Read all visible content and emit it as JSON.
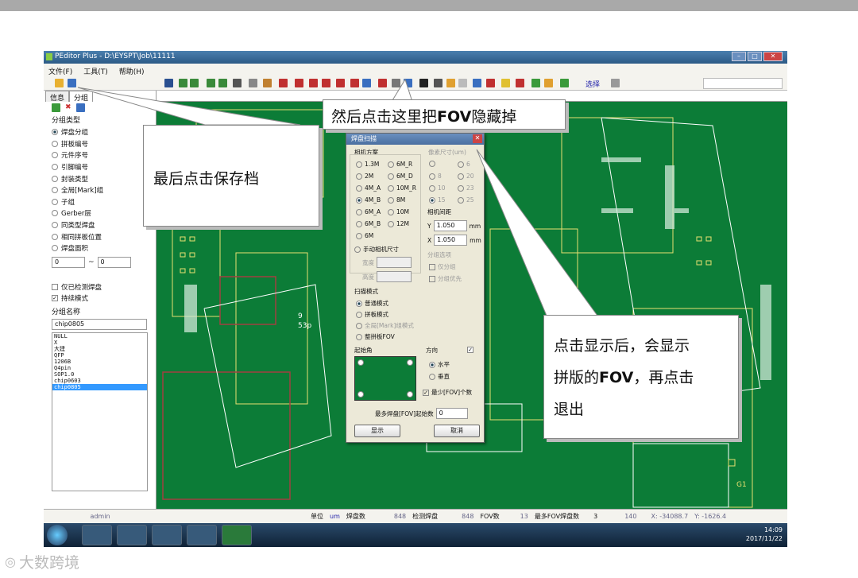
{
  "window": {
    "title": "PEditor Plus - D:\\EYSPT\\Job\\11111"
  },
  "menu": [
    "文件(F)",
    "工具(T)",
    "帮助(H)"
  ],
  "toolbar": {
    "select_label": "选择"
  },
  "left": {
    "tabs": [
      "信息",
      "分组"
    ],
    "group_type_label": "分组类型",
    "group_types": [
      {
        "label": "焊盘分组",
        "on": true
      },
      {
        "label": "拼板编号",
        "on": false
      },
      {
        "label": "元件序号",
        "on": false
      },
      {
        "label": "引脚编号",
        "on": false
      },
      {
        "label": "封装类型",
        "on": false
      },
      {
        "label": "全局[Mark]组",
        "on": false
      },
      {
        "label": "子组",
        "on": false
      },
      {
        "label": "Gerber层",
        "on": false
      },
      {
        "label": "同类型焊盘",
        "on": false
      },
      {
        "label": "相同拼板位置",
        "on": false
      },
      {
        "label": "焊盘面积",
        "on": false
      }
    ],
    "range_from": "0",
    "range_sep": "~",
    "range_to": "0",
    "only_checked": {
      "label": "仅已检测焊盘",
      "checked": false
    },
    "keep_mode": {
      "label": "持续模式",
      "checked": true
    },
    "group_name_label": "分组名称",
    "group_name": "chip0805",
    "list": [
      "NULL",
      "X",
      "大建",
      "QFP",
      "1206B",
      "Q4pin",
      "SOP1.0",
      "chip0603",
      "chip0805"
    ],
    "list_selected": 8
  },
  "status": {
    "user": "admin",
    "unit_label": "单位",
    "unit": "um",
    "pads_label": "焊盘数",
    "pads": "848",
    "checked_label": "检测焊盘",
    "checked": "848",
    "fov_label": "FOV数",
    "fov": "13",
    "maxfov_label": "最多FOV焊盘数",
    "maxfov": "3",
    "maxfov2": "140",
    "x": "X: -34088.7",
    "y": "Y: -1626.4"
  },
  "clock": {
    "time": "14:09",
    "date": "2017/11/22"
  },
  "dialog": {
    "title": "焊盘扫描",
    "cam_label": "相机方案",
    "cams": [
      [
        "1.3M",
        "6M_R"
      ],
      [
        "2M",
        "6M_D"
      ],
      [
        "4M_A",
        "10M_R"
      ],
      [
        "4M_B",
        "8M"
      ],
      [
        "6M_A",
        "10M"
      ],
      [
        "6M_B",
        "12M"
      ],
      [
        "6M",
        ""
      ]
    ],
    "cam_selected": "4M_B",
    "manual_cam": "手动相机尺寸",
    "width_label": "宽度",
    "height_label": "高度",
    "pixel_label": "像素尺寸(um)",
    "pixels": [
      [
        "",
        "6"
      ],
      [
        "8",
        "20"
      ],
      [
        "10",
        "23"
      ],
      [
        "15",
        "25"
      ]
    ],
    "spacing_label": "相机间距",
    "y_label": "Y",
    "y_val": "1.050",
    "x_label": "X",
    "x_val": "1.050",
    "mm": "mm",
    "group_opt_label": "分组选项",
    "only_group": "仅分组",
    "group_first": "分组优先",
    "scan_mode_label": "扫描模式",
    "scan_modes": [
      {
        "label": "普通模式",
        "on": true,
        "grey": false
      },
      {
        "label": "拼板模式",
        "on": false,
        "grey": false
      },
      {
        "label": "全局[Mark]组模式",
        "on": false,
        "grey": true
      },
      {
        "label": "整拼板FOV",
        "on": false,
        "grey": false
      }
    ],
    "start_label": "起始角",
    "dir_label": "方向",
    "horizontal": "水平",
    "vertical": "垂直",
    "min_fov": "最少[FOV]个数",
    "max_pad_label": "最多焊盘[FOV]起始数",
    "max_pad_val": "0",
    "show_btn": "显示",
    "cancel_btn": "取消"
  },
  "callouts": {
    "c1_pre": "然后点击这里把",
    "c1_bold": "FOV",
    "c1_post": "隐藏掉",
    "c2": "最后点击保存档",
    "c3_l1": "点击显示后，会显示",
    "c3_l2a": "拼版的",
    "c3_l2b": "FOV",
    "c3_l2c": "，再点击",
    "c3_l3": "退出"
  },
  "board": {
    "labels": [
      "9",
      "53p",
      "G1"
    ]
  },
  "watermark": "大数跨境",
  "colors": {
    "board": "#0c7c37",
    "pad": "#e8e070",
    "outline": "#ffffff"
  }
}
